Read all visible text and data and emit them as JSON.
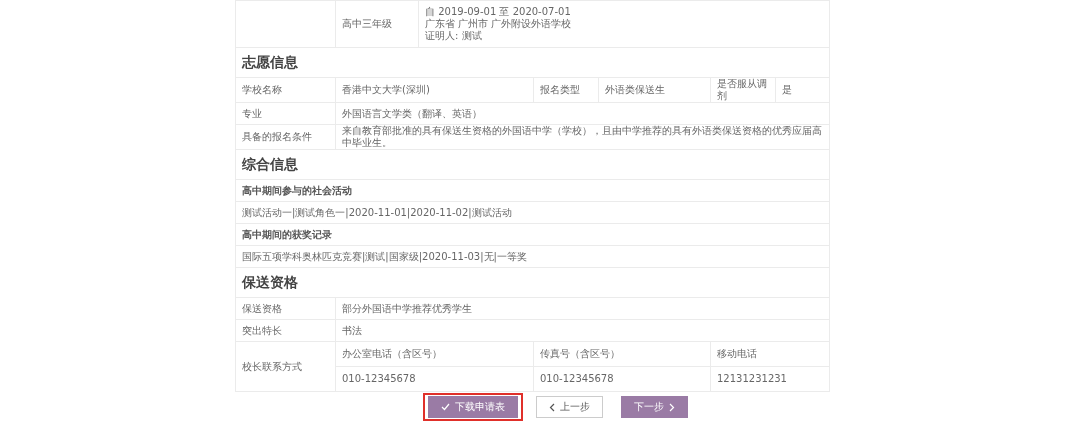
{
  "top_row": {
    "grade": "高中三年级",
    "lines": [
      "自 2019-09-01 至 2020-07-01",
      "广东省 广州市 广外附设外语学校",
      "证明人: 测试"
    ]
  },
  "sections": [
    {
      "title": "志愿信息",
      "rows": [
        {
          "kind": "pairs",
          "cells": [
            "学校名称",
            "香港中文大学(深圳)",
            "报名类型",
            "外语类保送生",
            "是否服从调剂",
            "是"
          ]
        },
        {
          "kind": "field",
          "label": "专业",
          "value": "外国语言文学类（翻译、英语）"
        },
        {
          "kind": "field",
          "label": "具备的报名条件",
          "value": "来自教育部批准的具有保送生资格的外国语中学（学校），且由中学推荐的具有外语类保送资格的优秀应届高中毕业生。"
        }
      ]
    },
    {
      "title": "综合信息",
      "rows": [
        {
          "kind": "subheading",
          "text": "高中期间参与的社会活动"
        },
        {
          "kind": "text",
          "text": "测试活动一|测试角色一|2020-11-01|2020-11-02|测试活动"
        },
        {
          "kind": "subheading",
          "text": "高中期间的获奖记录"
        },
        {
          "kind": "text",
          "text": "国际五项学科奥林匹克竞赛|测试|国家级|2020-11-03|无|一等奖"
        }
      ]
    },
    {
      "title": "保送资格",
      "rows": [
        {
          "kind": "field",
          "label": "保送资格",
          "value": "部分外国语中学推荐优秀学生"
        },
        {
          "kind": "field",
          "label": "突出特长",
          "value": "书法"
        },
        {
          "kind": "contacts",
          "label": "校长联系方式",
          "headers": [
            "办公室电话（含区号）",
            "传真号（含区号）",
            "移动电话"
          ],
          "values": [
            "010-12345678",
            "010-12345678",
            "12131231231"
          ]
        }
      ]
    }
  ],
  "buttons": [
    {
      "kind": "download",
      "label": "下载申请表",
      "highlighted": true
    },
    {
      "kind": "prev",
      "label": "上一步",
      "highlighted": false
    },
    {
      "kind": "next",
      "label": "下一步",
      "highlighted": false
    }
  ]
}
